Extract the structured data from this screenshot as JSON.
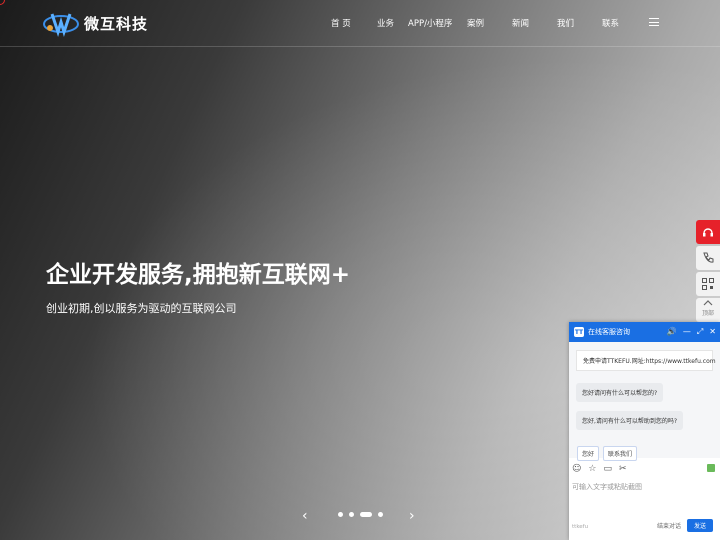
{
  "header": {
    "logo_text": "微互科技",
    "nav": [
      "首 页",
      "业务",
      "APP/小程序",
      "案例",
      "新闻",
      "我们",
      "联系"
    ]
  },
  "hero": {
    "title": "企业开发服务,拥抱新互联网+",
    "subtitle": "创业初期,创以服务为驱动的互联网公司",
    "slides_total": 4,
    "active_slide": 3,
    "prev_arrow": "‹",
    "next_arrow": "›"
  },
  "sidebar": {
    "top_label": "顶部"
  },
  "chat": {
    "title": "在线客服咨询",
    "logo": "TT",
    "promo": "免费申请TTKEFU.网址:https://www.ttkefu.com",
    "messages": [
      "您好请问有什么可以帮您的?",
      "您好,请问有什么可以帮助到您的吗?"
    ],
    "quick_replies": [
      "您好",
      "联系我们"
    ],
    "input_placeholder": "可输入文字或粘贴截图",
    "brand": "ttkefu",
    "end_label": "结束对话",
    "send_label": "发送"
  },
  "colors": {
    "accent_blue": "#1a6fe3",
    "accent_red": "#e6212a"
  }
}
